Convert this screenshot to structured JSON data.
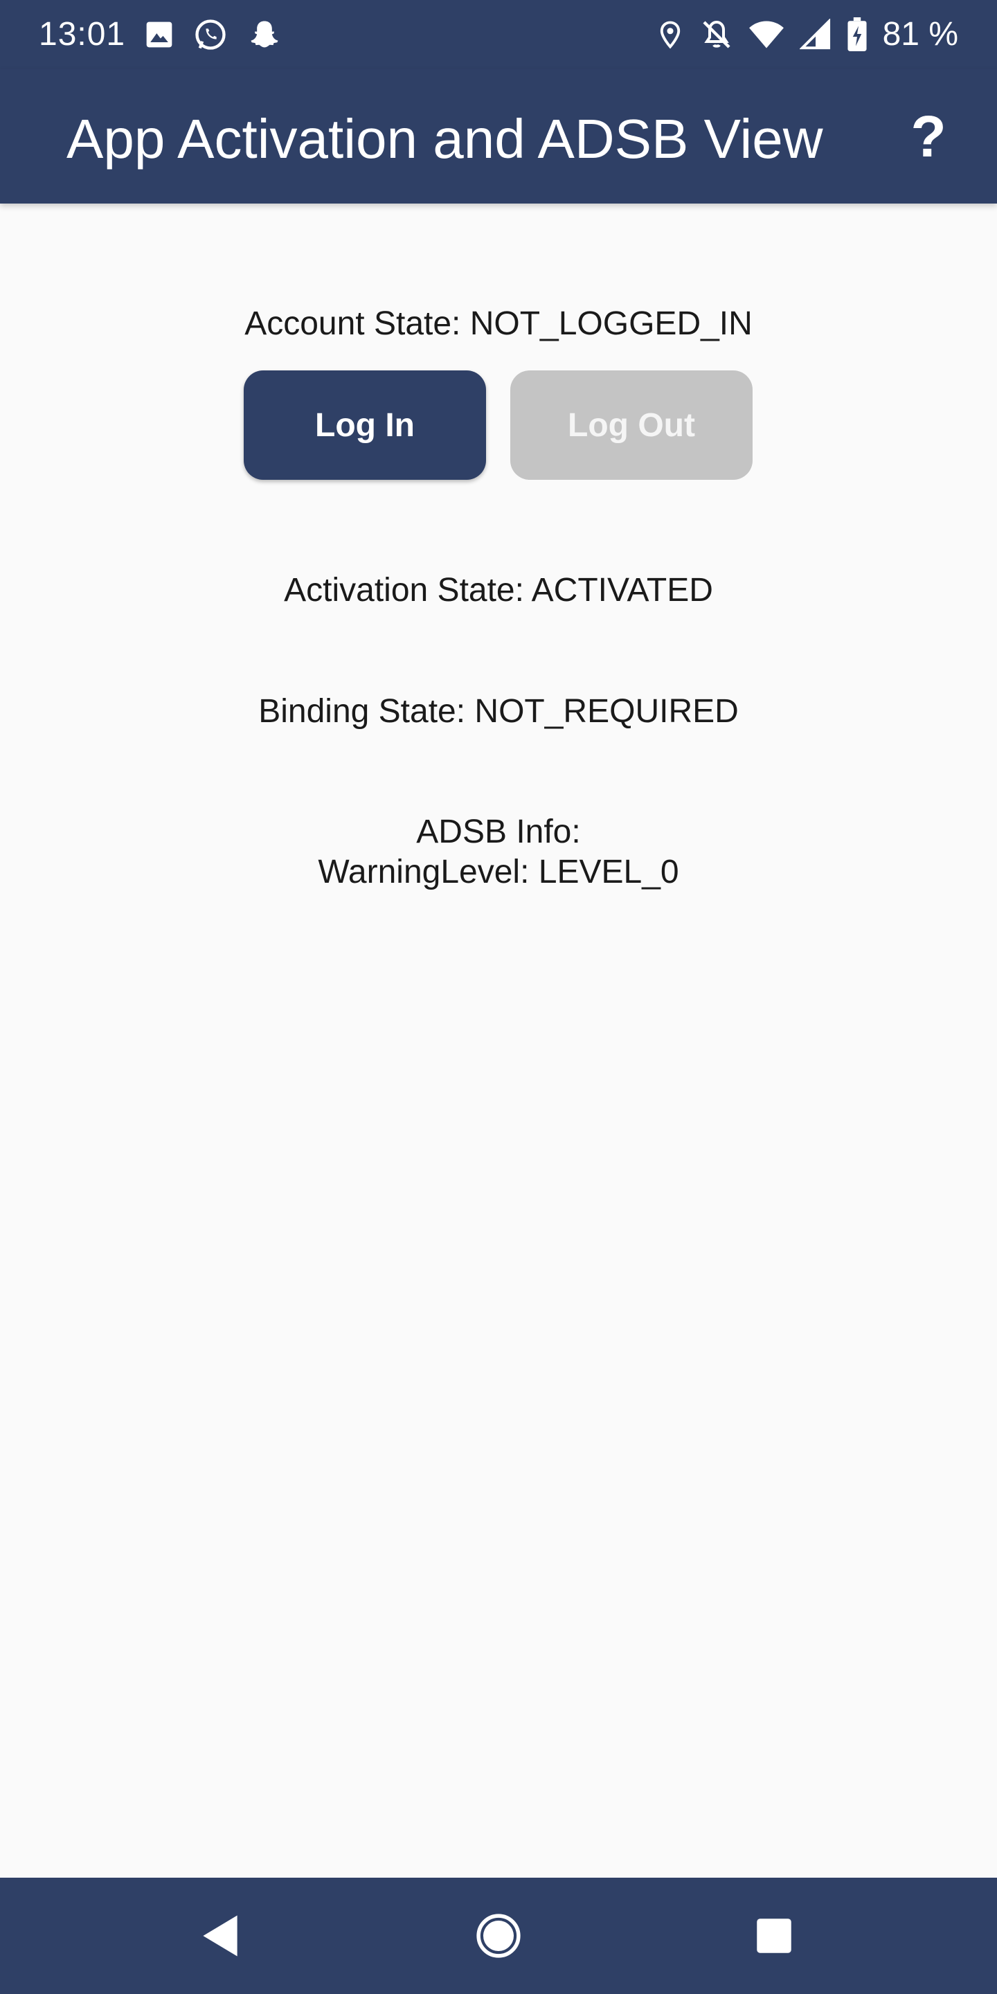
{
  "status_bar": {
    "time": "13:01",
    "battery": "81 %",
    "icons_left": [
      "image-icon",
      "whatsapp-icon",
      "snapchat-icon"
    ],
    "icons_right": [
      "location-icon",
      "notifications-off-icon",
      "wifi-icon",
      "signal-icon",
      "battery-charging-icon"
    ]
  },
  "app_bar": {
    "title": "App Activation and ADSB View",
    "help_label": "?"
  },
  "account": {
    "state_text": "Account State: NOT_LOGGED_IN",
    "login_label": "Log In",
    "logout_label": "Log Out"
  },
  "activation": {
    "state_text": "Activation State: ACTIVATED"
  },
  "binding": {
    "state_text": "Binding State: NOT_REQUIRED"
  },
  "adsb": {
    "info_label": "ADSB Info:",
    "warning_text": "WarningLevel: LEVEL_0"
  },
  "nav_bar": {
    "icons": [
      "back-icon",
      "home-icon",
      "recents-icon"
    ]
  },
  "colors": {
    "primary": "#2f4066",
    "background": "#fafafa",
    "disabled_button": "#c4c4c4"
  }
}
